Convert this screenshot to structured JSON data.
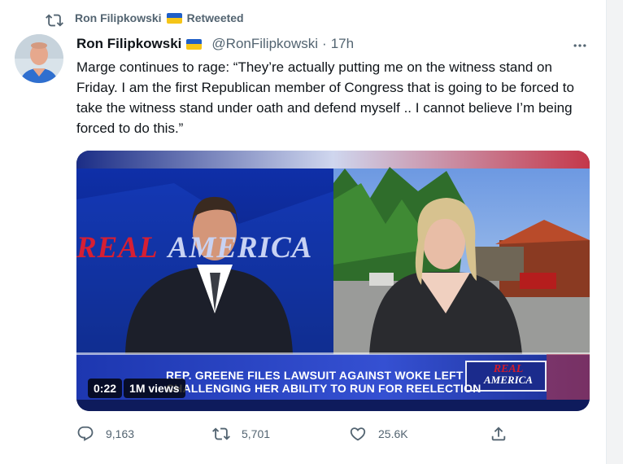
{
  "retweet": {
    "user": "Ron Filipkowski",
    "label": "Retweeted",
    "icon": "retweet-icon"
  },
  "flag": {
    "top": "#1f5fc7",
    "bottom": "#f5c518"
  },
  "author": {
    "name": "Ron Filipkowski",
    "handle": "@RonFilipkowski",
    "separator": "·",
    "time": "17h"
  },
  "tweet": {
    "text": "Marge continues to rage: “They’re actually putting me on the witness stand on Friday. I am the first Republican member of Congress that is going to be forced to take the witness stand under oath and defend myself .. I cannot believe I’m being forced to do this.”"
  },
  "video": {
    "duration": "0:22",
    "views": "1M views",
    "wall_text_1": "REAL",
    "wall_text_2": "AMERICA",
    "chyron_line1": "REP. GREENE FILES LAWSUIT AGAINST WOKE LEFT",
    "chyron_line2": "CHALLENGING HER ABILITY TO RUN FOR REELECTION",
    "logo_line1": "REAL",
    "logo_line2": "AMERICA"
  },
  "actions": {
    "replies": "9,163",
    "retweets": "5,701",
    "likes": "25.6K"
  },
  "colors": {
    "text_secondary": "#536471",
    "text_primary": "#0f1419",
    "chyron_blue": "#2b46c8"
  }
}
